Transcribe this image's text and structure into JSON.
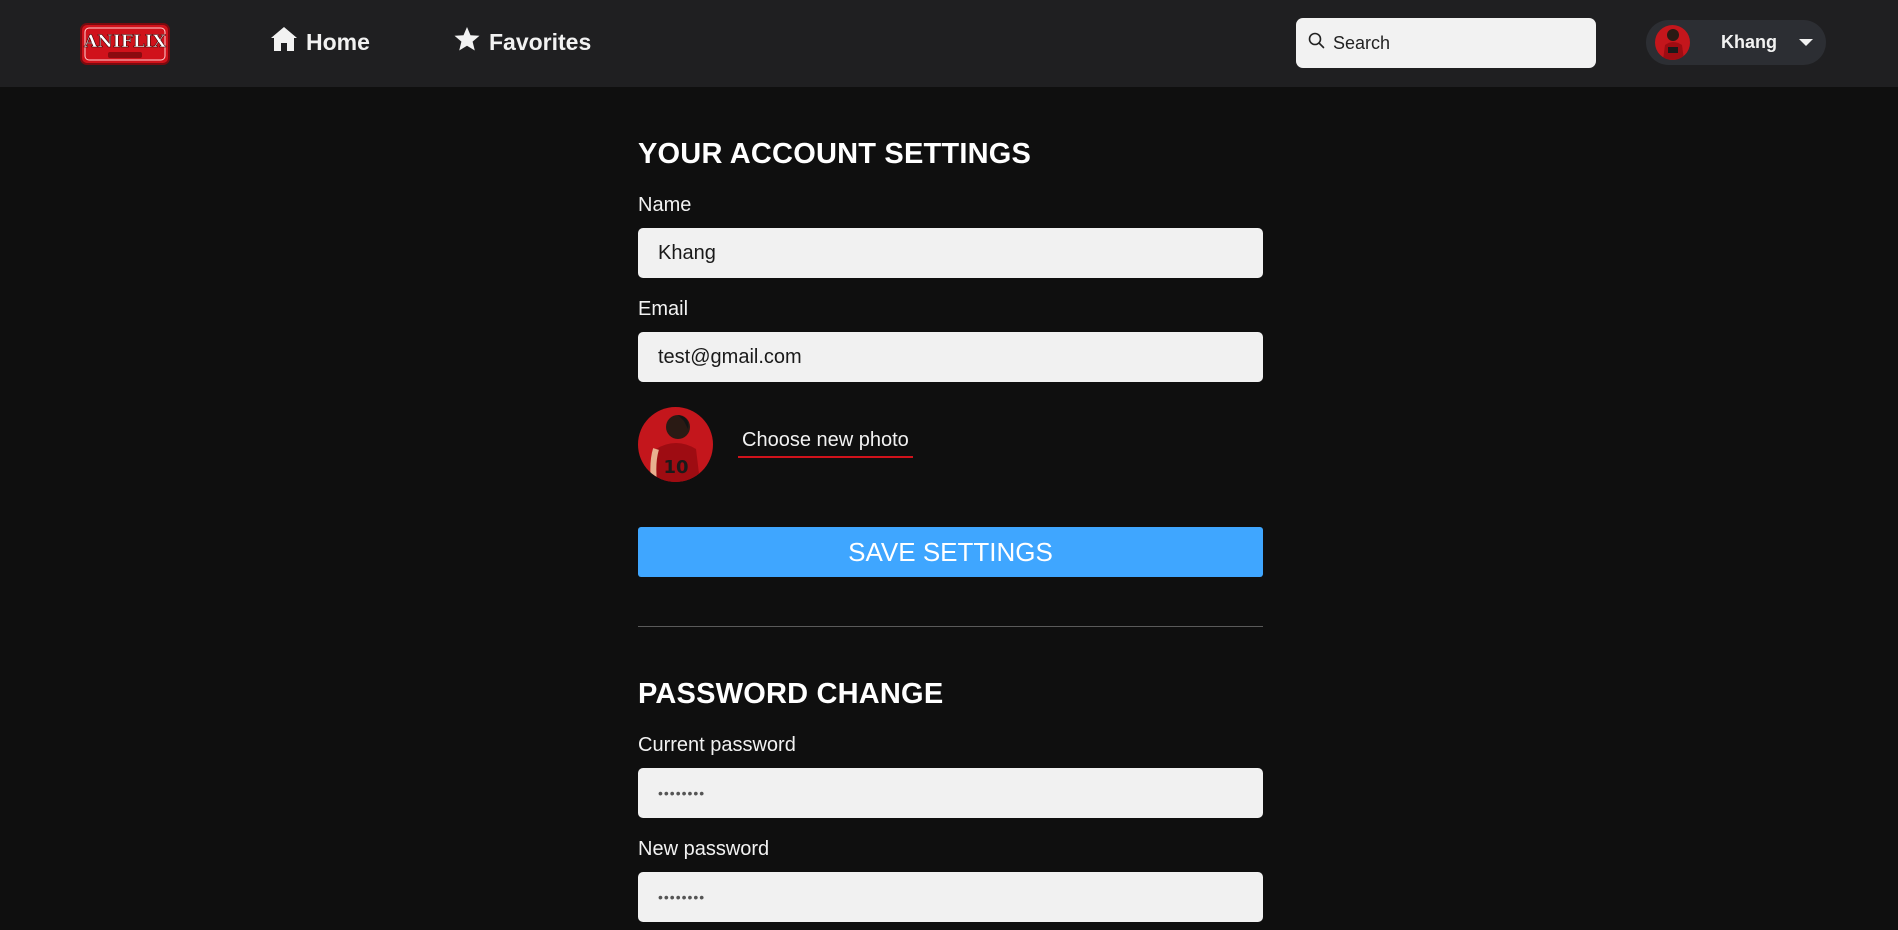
{
  "header": {
    "logo_text": "ANIFLIX",
    "nav": [
      {
        "label": "Home",
        "icon": "home-icon"
      },
      {
        "label": "Favorites",
        "icon": "star-icon"
      }
    ],
    "search": {
      "placeholder": "Search",
      "value": ""
    },
    "user": {
      "name": "Khang",
      "caret_icon": "caret-down-icon"
    }
  },
  "account_settings": {
    "title": "YOUR ACCOUNT SETTINGS",
    "name_label": "Name",
    "name_value": "Khang",
    "email_label": "Email",
    "email_value": "test@gmail.com",
    "choose_photo_label": "Choose new photo",
    "save_label": "SAVE SETTINGS"
  },
  "password_change": {
    "title": "PASSWORD CHANGE",
    "current_label": "Current password",
    "current_value": "••••••••",
    "new_label": "New password",
    "new_value": "••••••••"
  },
  "colors": {
    "background": "#0f0f0f",
    "header": "#1f1f21",
    "accent_blue": "#3fa6ff",
    "accent_red": "#d0121b",
    "input_bg": "#f1f1f1"
  }
}
